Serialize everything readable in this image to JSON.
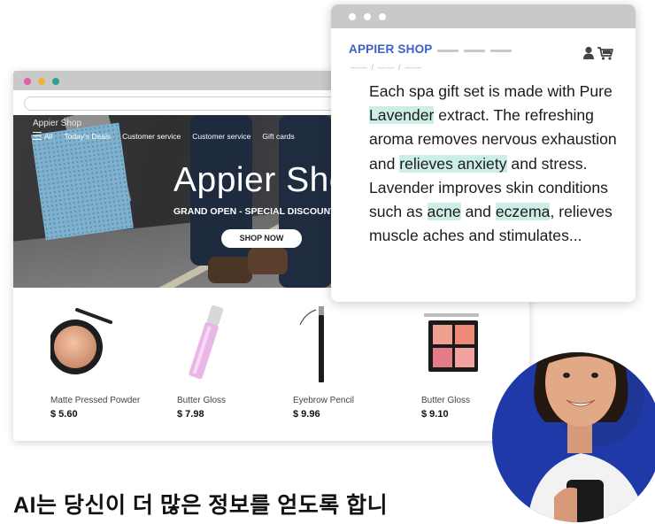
{
  "back_window": {
    "dots": [
      "#e55ea0",
      "#f2b134",
      "#2f9f8f"
    ],
    "hero": {
      "shop_name": "Appier  Shop",
      "nav": [
        "All",
        "Today's Deals",
        "Customer service",
        "Customer service",
        "Gift cards"
      ],
      "title": "Appier  Shop",
      "subtitle": "GRAND OPEN - SPECIAL DISCOUNT",
      "cta": "SHOP NOW"
    },
    "products": [
      {
        "name": "Matte Pressed Powder",
        "price": "$ 5.60"
      },
      {
        "name": "Butter Gloss",
        "price": "$ 7.98"
      },
      {
        "name": "Eyebrow Pencil",
        "price": "$ 9.96"
      },
      {
        "name": "Butter Gloss",
        "price": "$ 9.10"
      }
    ]
  },
  "front_window": {
    "brand": "APPIER SHOP",
    "crumb": "—— / —— / ——",
    "text": {
      "p1": "Each spa gift set is made with Pure ",
      "h1": "Lavender",
      "p2": " extract. The refreshing aroma removes nervous exhaustion and ",
      "h2": "relieves anxiety",
      "p3": " and stress. Lavender improves skin conditions such as ",
      "h3": "acne",
      "p4": " and ",
      "h4": "eczema",
      "p5": ", relieves muscle aches and stimulates..."
    },
    "highlight_color": "#cdeee7",
    "brand_color": "#3e5ec9"
  },
  "caption": "AI는 당신이 더 많은 정보를 얻도록 합니"
}
